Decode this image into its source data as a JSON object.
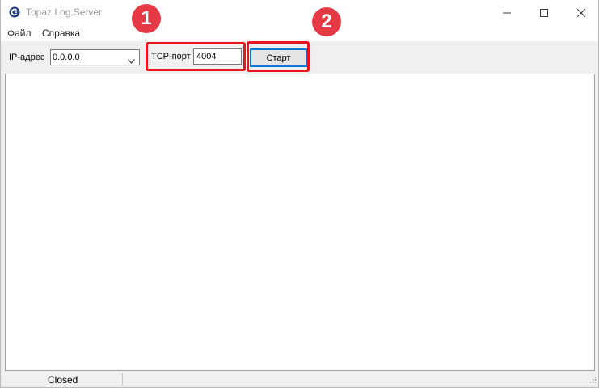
{
  "window": {
    "title": "Topaz Log Server",
    "controls": {
      "minimize": "minimize-icon",
      "maximize": "maximize-icon",
      "close": "close-icon"
    }
  },
  "menu": {
    "items": [
      {
        "label": "Файл"
      },
      {
        "label": "Справка"
      }
    ]
  },
  "toolbar": {
    "ip_label": "IP-адрес",
    "ip_value": "0.0.0.0",
    "port_label": "TCP-порт",
    "port_value": "4004",
    "start_label": "Старт"
  },
  "annotations": [
    {
      "number": "1"
    },
    {
      "number": "2"
    }
  ],
  "status": {
    "text": "Closed"
  },
  "colors": {
    "accent": "#0078d7",
    "annotation_border": "#e8141e",
    "annotation_badge": "#e63946"
  }
}
